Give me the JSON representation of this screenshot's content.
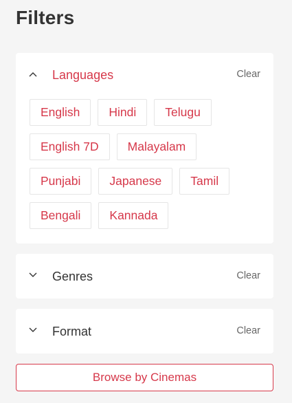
{
  "page": {
    "title": "Filters"
  },
  "colors": {
    "accent": "#d6384a",
    "text": "#333333",
    "muted": "#666666",
    "border": "#e5e5e5"
  },
  "languages": {
    "label": "Languages",
    "clear_label": "Clear",
    "expanded": true,
    "options": [
      [
        "English",
        "Hindi",
        "Telugu"
      ],
      [
        "English 7D",
        "Malayalam"
      ],
      [
        "Punjabi",
        "Japanese",
        "Tamil"
      ],
      [
        "Bengali",
        "Kannada"
      ]
    ]
  },
  "genres": {
    "label": "Genres",
    "clear_label": "Clear",
    "expanded": false
  },
  "format": {
    "label": "Format",
    "clear_label": "Clear",
    "expanded": false
  },
  "browse": {
    "label": "Browse by Cinemas"
  },
  "icons": {
    "expanded": "chevron-up-icon",
    "collapsed": "chevron-down-icon"
  }
}
